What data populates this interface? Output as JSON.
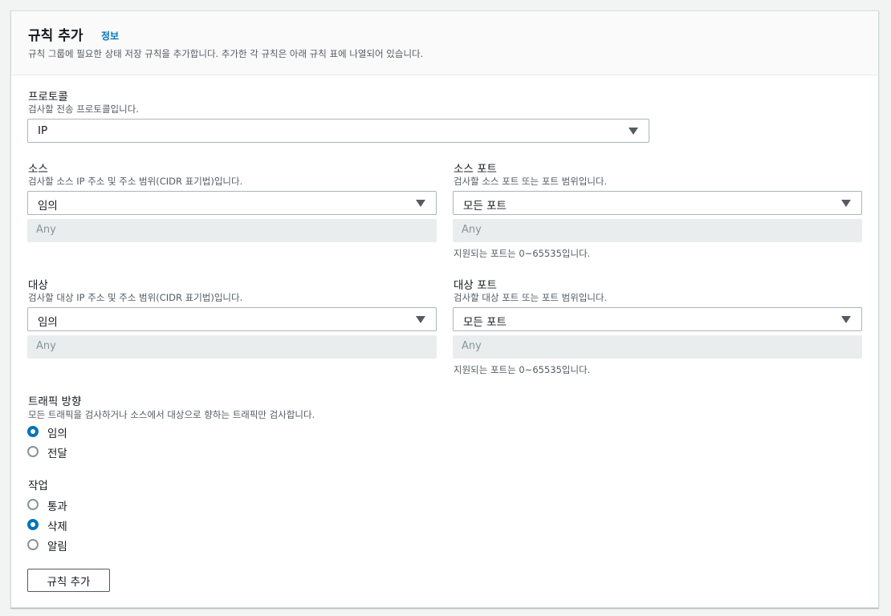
{
  "header": {
    "title": "규칙 추가",
    "info_link": "정보",
    "description": "규칙 그룹에 필요한 상태 저장 규칙을 추가합니다. 추가한 각 규칙은 아래 규칙 표에 나열되어 있습니다."
  },
  "protocol": {
    "label": "프로토콜",
    "description": "검사할 전송 프로토콜입니다.",
    "selected": "IP"
  },
  "source": {
    "label": "소스",
    "description": "검사할 소스 IP 주소 및 주소 범위(CIDR 표기법)입니다.",
    "selected": "임의",
    "input_placeholder": "Any"
  },
  "source_port": {
    "label": "소스 포트",
    "description": "검사할 소스 포트 또는 포트 범위입니다.",
    "selected": "모든 포트",
    "input_placeholder": "Any",
    "hint": "지원되는 포트는 0~65535입니다."
  },
  "destination": {
    "label": "대상",
    "description": "검사할 대상 IP 주소 및 주소 범위(CIDR 표기법)입니다.",
    "selected": "임의",
    "input_placeholder": "Any"
  },
  "destination_port": {
    "label": "대상 포트",
    "description": "검사할 대상 포트 또는 포트 범위입니다.",
    "selected": "모든 포트",
    "input_placeholder": "Any",
    "hint": "지원되는 포트는 0~65535입니다."
  },
  "traffic_direction": {
    "label": "트래픽 방향",
    "description": "모든 트래픽을 검사하거나 소스에서 대상으로 향하는 트래픽만 검사합니다.",
    "options": [
      {
        "label": "임의",
        "checked": true
      },
      {
        "label": "전달",
        "checked": false
      }
    ]
  },
  "action": {
    "label": "작업",
    "options": [
      {
        "label": "통과",
        "checked": false
      },
      {
        "label": "삭제",
        "checked": true
      },
      {
        "label": "알림",
        "checked": false
      }
    ]
  },
  "add_rule_button": "규칙 추가",
  "colors": {
    "accent": "#0073bb",
    "text": "#16191f",
    "secondary_text": "#545b64",
    "disabled_bg": "#eaeded"
  }
}
